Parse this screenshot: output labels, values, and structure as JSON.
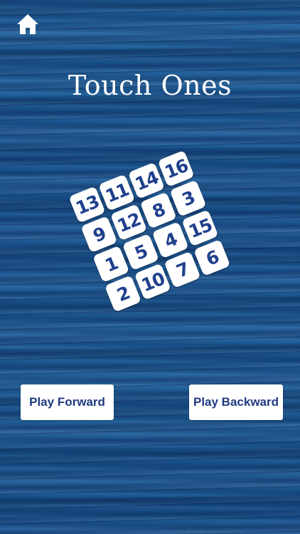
{
  "title": "Touch Ones",
  "colors": {
    "background": "#1d5a93",
    "tile": "#ffffff",
    "digit": "#1f3f8c",
    "button_text": "#1f3a80"
  },
  "home_button": {
    "icon": "home-icon"
  },
  "board": {
    "rows": [
      [
        "13",
        "11",
        "14",
        "16"
      ],
      [
        "9",
        "12",
        "8",
        "3"
      ],
      [
        "1",
        "5",
        "4",
        "15"
      ],
      [
        "2",
        "10",
        "7",
        "6"
      ]
    ]
  },
  "buttons": {
    "play_forward": "Play Forward",
    "play_backward": "Play Backward"
  }
}
